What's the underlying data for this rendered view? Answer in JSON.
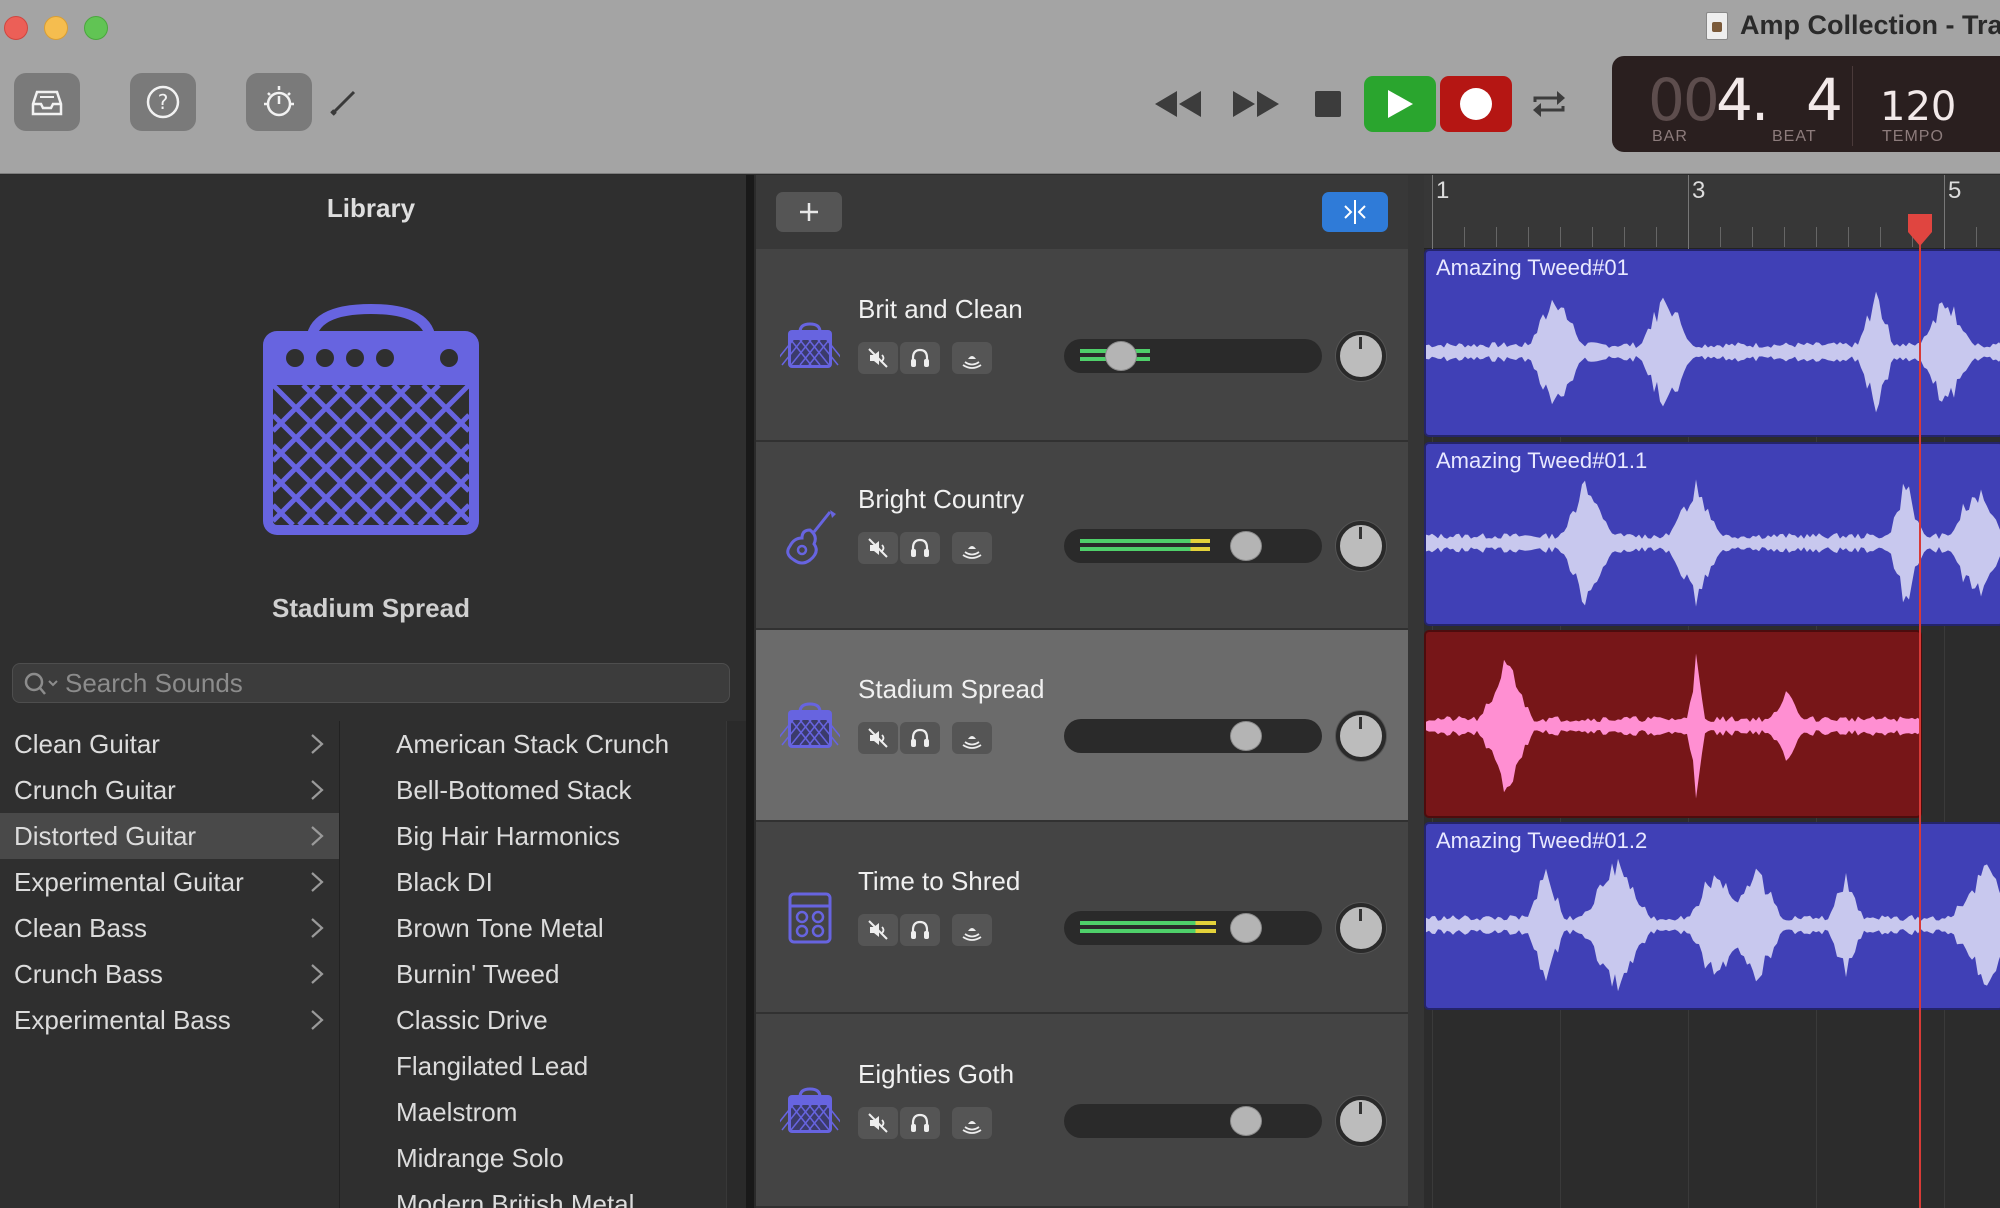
{
  "window": {
    "title": "Amp Collection - Tra"
  },
  "transport": {
    "lcd": {
      "bar_dim": "00",
      "bar": "4.",
      "beat": "4",
      "bar_label": "BAR",
      "beat_label": "BEAT",
      "tempo": "120",
      "tempo_label": "TEMPO"
    }
  },
  "library": {
    "title": "Library",
    "selected_patch": "Stadium Spread",
    "search_placeholder": "Search Sounds",
    "categories": [
      {
        "label": "Clean Guitar"
      },
      {
        "label": "Crunch Guitar"
      },
      {
        "label": "Distorted Guitar",
        "selected": true
      },
      {
        "label": "Experimental Guitar"
      },
      {
        "label": "Clean Bass"
      },
      {
        "label": "Crunch Bass"
      },
      {
        "label": "Experimental Bass"
      }
    ],
    "patches": [
      "American Stack Crunch",
      "Bell-Bottomed Stack",
      "Big Hair Harmonics",
      "Black DI",
      "Brown Tone Metal",
      "Burnin' Tweed",
      "Classic Drive",
      "Flangilated Lead",
      "Maelstrom",
      "Midrange Solo",
      "Modern British Metal"
    ]
  },
  "ruler": {
    "bars": [
      "1",
      "3",
      "5"
    ]
  },
  "tracks": [
    {
      "name": "Brit and Clean",
      "icon": "amp-icon",
      "volume": 0.2,
      "meter": 0.35,
      "region": "Amazing Tweed#01",
      "color": "#4040b6"
    },
    {
      "name": "Bright Country",
      "icon": "guitar-icon",
      "volume": 0.75,
      "meter": 0.65,
      "region": "Amazing Tweed#01.1",
      "color": "#4040b6"
    },
    {
      "name": "Stadium Spread",
      "icon": "amp-icon",
      "volume": 0.75,
      "meter": 0,
      "region": "",
      "color": "#771618",
      "selected": true
    },
    {
      "name": "Time to Shred",
      "icon": "amp-stack-icon",
      "volume": 0.75,
      "meter": 0.68,
      "region": "Amazing Tweed#01.2",
      "color": "#4040b6"
    },
    {
      "name": "Eighties Goth",
      "icon": "amp-icon",
      "volume": 0.75,
      "meter": 0,
      "region": "",
      "color": ""
    }
  ],
  "colors": {
    "accent": "#6764e0",
    "region_purple": "#4040b6",
    "region_red": "#771618",
    "play": "#2aa52e",
    "record": "#b51613",
    "playhead": "#d83a36"
  }
}
